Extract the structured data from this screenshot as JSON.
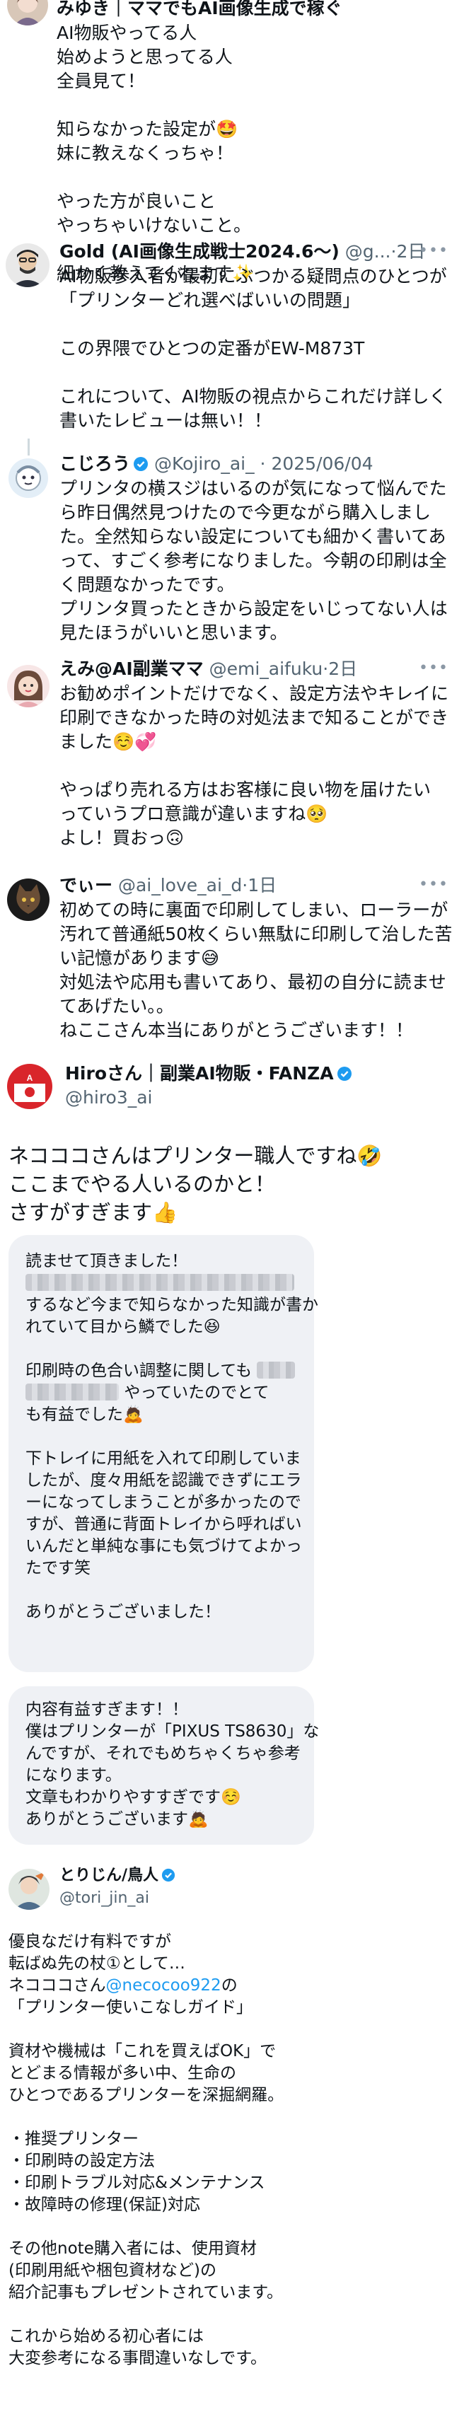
{
  "colors": {
    "verified": "#1d9bf0",
    "link": "#1d9bf0",
    "bubble": "#eff1f5",
    "handle": "#536471"
  },
  "post1": {
    "name": "みゆき｜ママでもAI画像生成で稼ぐ",
    "lines": [
      "AI物販やってる人",
      "始めようと思ってる人",
      "全員見て！",
      "",
      "知らなかった設定が🤩",
      "妹に教えなくっちゃ！",
      "",
      "やった方が良いこと",
      "やっちゃいけないこと。",
      "",
      "細かく教えてくれます✨"
    ]
  },
  "post2": {
    "name": "Gold (AI画像生成戦士2024.6〜)",
    "handle": "@g...",
    "time": "2日",
    "lines": [
      "AI物販参入者が最初にぶつかる疑問点のひとつが",
      "「プリンターどれ選べばいいの問題」",
      "",
      "この界隈でひとつの定番がEW-M873T",
      "",
      "これについて、AI物販の視点からこれだけ詳しく",
      "書いたレビューは無い！！"
    ]
  },
  "post3": {
    "name": "こじろう",
    "handle": "@Kojiro_ai_",
    "time": "2025/06/04",
    "lines": [
      "プリンタの横スジはいるのが気になって悩んでた",
      "ら昨日偶然見つけたので今更ながら購入しまし",
      "た。全然知らない設定についても細かく書いてあ",
      "って、すごく参考になりました。今朝の印刷は全",
      "く問題なかったです。",
      "プリンタ買ったときから設定をいじってない人は",
      "見たほうがいいと思います。"
    ]
  },
  "post4": {
    "name": "えみ@AI副業ママ",
    "handle": "@emi_aifuku",
    "time": "2日",
    "lines": [
      "お勧めポイントだけでなく、設定方法やキレイに",
      "印刷できなかった時の対処法まで知ることができ",
      "ました☺️💞",
      "",
      "やっぱり売れる方はお客様に良い物を届けたい",
      "っていうプロ意識が違いますね🥺",
      "よし！買おっ🙃"
    ]
  },
  "post5": {
    "name": "でぃー",
    "handle": "@ai_love_ai_d",
    "time": "1日",
    "lines": [
      "初めての時に裏面で印刷してしまい、ローラーが",
      "汚れて普通紙50枚くらい無駄に印刷して治した苦",
      "い記憶があります😅",
      "対処法や応用も書いてあり、最初の自分に読ませ",
      "てあげたい。。",
      "ねここさん本当にありがとうございます！！"
    ]
  },
  "post6": {
    "name": "Hiroさん｜副業AI物販・FANZA",
    "handle": "@hiro3_ai",
    "lines": [
      "ネコココさんはプリンター職人ですね🤣",
      "ここまでやる人いるのかと！",
      "さすがすぎます👍"
    ],
    "dm1": {
      "l1": "読ませて頂きました！",
      "l3": "するなど今まで知らなかった知識が書か",
      "l4": "れていて目から鱗でした😆",
      "l6": "印刷時の色合い調整に関しても",
      "l8": "やっていたのでとて",
      "l9": "も有益でした🙇",
      "rest": [
        "下トレイに用紙を入れて印刷していま",
        "したが、度々用紙を認識できずにエラ",
        "ーになってしまうことが多かったので",
        "すが、普通に背面トレイから呼ればい",
        "いんだと単純な事にも気づけてよかっ",
        "たです笑",
        "",
        "ありがとうございました！"
      ]
    },
    "dm2": {
      "lines": [
        "内容有益すぎます！！",
        "僕はプリンターが「PIXUS TS8630」な",
        "んですが、それでもめちゃくちゃ参考",
        "になります。",
        "文章もわかりやすすぎです☺️",
        "ありがとうございます🙇"
      ]
    }
  },
  "post7": {
    "name": "とりじん/鳥人",
    "handle": "@tori_jin_ai",
    "lines_a": [
      "優良なだけ有料ですが",
      "転ばぬ先の杖①として…"
    ],
    "mention_prefix": "ネコココさん",
    "mention": "@necocoo922",
    "mention_suffix": "の",
    "lines_b": [
      "「プリンター使いこなしガイド」",
      "",
      "資材や機械は「これを買えばOK」で",
      "とどまる情報が多い中、生命の",
      "ひとつであるプリンターを深掘網羅。",
      "",
      "・推奨プリンター",
      "・印刷時の設定方法",
      "・印刷トラブル対応&メンテナンス",
      "・故障時の修理(保証)対応",
      "",
      "その他note購入者には、使用資材",
      "(印刷用紙や梱包資材など)の",
      "紹介記事もプレゼントされています。",
      "",
      "これから始める初心者には",
      "大変参考になる事間違いなしです。"
    ]
  }
}
